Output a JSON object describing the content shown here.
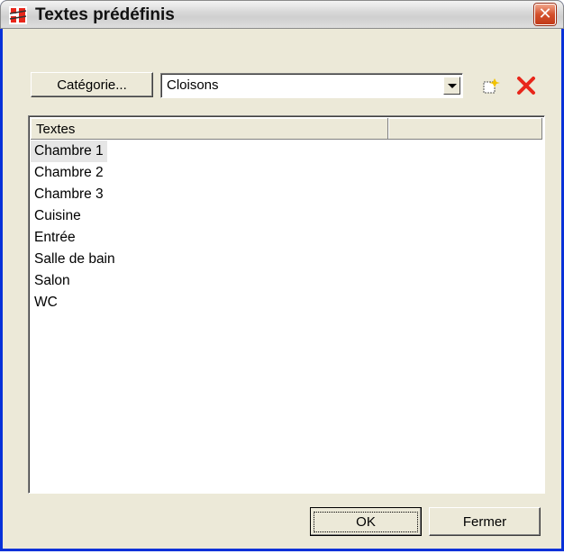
{
  "window": {
    "title": "Textes prédéfinis",
    "app_icon": "app-logo-icon",
    "close_icon": "close-icon"
  },
  "toolbar": {
    "category_button_label": "Catégorie...",
    "category_value": "Cloisons",
    "new_icon": "new-item-icon",
    "delete_icon": "delete-icon"
  },
  "list": {
    "columns": [
      "Textes",
      ""
    ],
    "rows": [
      "Chambre 1",
      "Chambre 2",
      "Chambre 3",
      "Cuisine",
      "Entrée",
      "Salle de bain",
      "Salon",
      "WC"
    ],
    "selected_index": 0
  },
  "footer": {
    "ok_label": "OK",
    "close_label": "Fermer"
  },
  "colors": {
    "dialog_bg": "#ece9d8",
    "close_button": "#d4502c",
    "delete_red": "#e8261a"
  }
}
